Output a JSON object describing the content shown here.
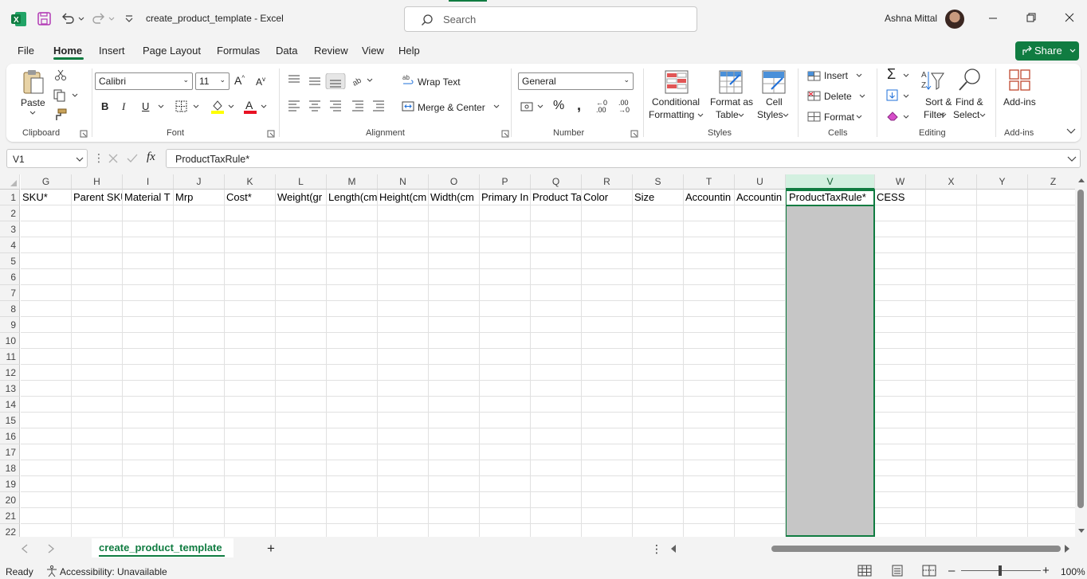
{
  "title_bar": {
    "doc_title": "create_product_template  -  Excel",
    "search_placeholder": "Search",
    "user_name": "Ashna Mittal"
  },
  "menu": {
    "items": [
      "File",
      "Home",
      "Insert",
      "Page Layout",
      "Formulas",
      "Data",
      "Review",
      "View",
      "Help"
    ],
    "active": "Home",
    "share_label": "Share"
  },
  "ribbon": {
    "clipboard": {
      "paste": "Paste",
      "group": "Clipboard"
    },
    "font": {
      "family": "Calibri",
      "size": "11",
      "group": "Font"
    },
    "alignment": {
      "wrap_text": "Wrap Text",
      "merge_center": "Merge & Center",
      "group": "Alignment"
    },
    "number": {
      "format": "General",
      "group": "Number"
    },
    "styles": {
      "conditional_1": "Conditional",
      "conditional_2": "Formatting",
      "format_table_1": "Format as",
      "format_table_2": "Table",
      "cell_styles_1": "Cell",
      "cell_styles_2": "Styles",
      "group": "Styles"
    },
    "cells": {
      "insert": "Insert",
      "delete": "Delete",
      "format": "Format",
      "group": "Cells"
    },
    "editing": {
      "sort_1": "Sort &",
      "sort_2": "Filter",
      "find_1": "Find &",
      "find_2": "Select",
      "group": "Editing"
    },
    "addins": {
      "label": "Add-ins",
      "group": "Add-ins"
    }
  },
  "formula_bar": {
    "name_box": "V1",
    "fx": "fx",
    "content": "ProductTaxRule*"
  },
  "grid": {
    "columns": [
      "G",
      "H",
      "I",
      "J",
      "K",
      "L",
      "M",
      "N",
      "O",
      "P",
      "Q",
      "R",
      "S",
      "T",
      "U",
      "V",
      "W",
      "X",
      "Y",
      "Z"
    ],
    "selected_column": "V",
    "rows": [
      "1",
      "2",
      "3",
      "4",
      "5",
      "6",
      "7",
      "8",
      "9",
      "10",
      "11",
      "12",
      "13",
      "14",
      "15",
      "16",
      "17",
      "18",
      "19",
      "20",
      "21",
      "22"
    ],
    "row1": [
      "SKU*",
      "Parent SKU",
      "Material T",
      "Mrp",
      "Cost*",
      "Weight(gr",
      "Length(cm",
      "Height(cm",
      "Width(cm",
      "Primary In",
      "Product Ta",
      "Color",
      "Size",
      "Accountin",
      "Accountin",
      "ProductTaxRule*",
      "CESS",
      "",
      "",
      ""
    ]
  },
  "sheets": {
    "active": "create_product_template",
    "add": "+"
  },
  "status": {
    "ready": "Ready",
    "accessibility": "Accessibility: Unavailable",
    "zoom": "100%"
  }
}
